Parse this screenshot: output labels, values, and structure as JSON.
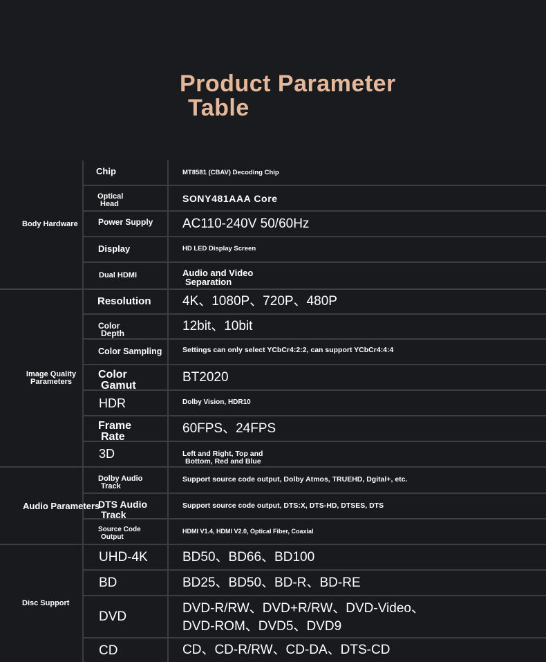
{
  "title": {
    "line1": "Product Parameter",
    "line2": "Table"
  },
  "groups": [
    {
      "label": "Body Hardware"
    },
    {
      "label_1": "Image Quality",
      "label_2": "Parameters"
    },
    {
      "label": "Audio Parameters"
    },
    {
      "label": "Disc Support"
    }
  ],
  "rows": [
    {
      "key": "Chip",
      "value": "MT8581 (CBAV) Decoding Chip"
    },
    {
      "key_1": "Optical",
      "key_2": "Head",
      "value": "SONY481AAA Core"
    },
    {
      "key": "Power Supply",
      "value": "AC110-240V 50/60Hz"
    },
    {
      "key": "Display",
      "value": "HD LED Display Screen"
    },
    {
      "key": "Dual HDMI",
      "value_1": "Audio and Video",
      "value_2": "Separation"
    },
    {
      "key": "Resolution",
      "value": "4K、1080P、720P、480P"
    },
    {
      "key_1": "Color",
      "key_2": "Depth",
      "value": "12bit、10bit"
    },
    {
      "key": "Color Sampling",
      "value": "Settings can only select YCbCr4:2:2, can support YCbCr4:4:4"
    },
    {
      "key_1": "Color",
      "key_2": "Gamut",
      "value": "BT2020"
    },
    {
      "key": "HDR",
      "value": "Dolby Vision, HDR10"
    },
    {
      "key_1": "Frame",
      "key_2": "Rate",
      "value": "60FPS、24FPS"
    },
    {
      "key": "3D",
      "value_1": "Left and Right, Top and",
      "value_2": "Bottom, Red and Blue"
    },
    {
      "key_1": "Dolby Audio",
      "key_2": "Track",
      "value": "Support source code output, Dolby Atmos, TRUEHD, Dgital+, etc."
    },
    {
      "key_1": "DTS Audio",
      "key_2": "Track",
      "value": "Support source code output, DTS:X, DTS-HD, DTSES, DTS"
    },
    {
      "key_1": "Source Code",
      "key_2": "Output",
      "value": "HDMI V1.4, HDMI V2.0, Optical Fiber, Coaxial"
    },
    {
      "key": "UHD-4K",
      "value": "BD50、BD66、BD100"
    },
    {
      "key": "BD",
      "value": "BD25、BD50、BD-R、BD-RE"
    },
    {
      "key": "DVD",
      "value_1": "DVD-R/RW、DVD+R/RW、DVD-Video、",
      "value_2": "DVD-ROM、DVD5、DVD9"
    },
    {
      "key": "CD",
      "value": "CD、CD-R/RW、CD-DA、DTS-CD"
    }
  ]
}
